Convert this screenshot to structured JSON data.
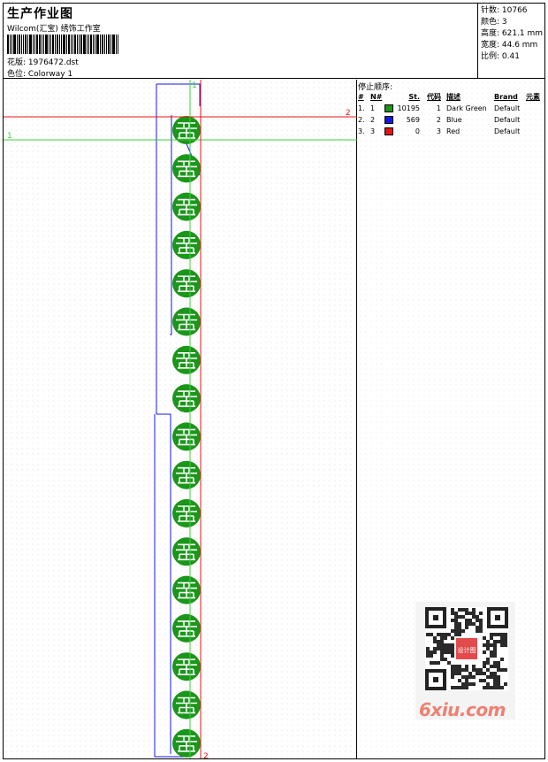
{
  "header": {
    "title": "生产作业图",
    "company": "Wilcom(汇宝) 绣饰工作室",
    "design": "花版:  1976472.dst",
    "colorway": "色位:  Colorway 1"
  },
  "stats": {
    "stitches": "针数:  10766",
    "colors": "颜色:  3",
    "height": "高度:  621.1 mm",
    "width": "宽度:  44.6 mm",
    "scale": "比例:  0.41"
  },
  "stop_sequence": {
    "heading": "停止顺序:",
    "columns": {
      "num": "#",
      "n": "N#",
      "stitches": "St.",
      "code": "代码",
      "desc": "描述",
      "brand": "Brand",
      "element": "元素"
    },
    "rows": [
      {
        "num": "1.",
        "n": "1",
        "color": "#1a961a",
        "stitches": "10195",
        "code": "1",
        "desc": "Dark Green",
        "brand": "Default"
      },
      {
        "num": "2.",
        "n": "2",
        "color": "#1515e6",
        "stitches": "569",
        "code": "2",
        "desc": "Blue",
        "brand": "Default"
      },
      {
        "num": "3.",
        "n": "3",
        "color": "#e61414",
        "stitches": "0",
        "code": "3",
        "desc": "Red",
        "brand": "Default"
      }
    ]
  },
  "guides": {
    "green_marker_top": "1",
    "green_marker_left": "1",
    "red_marker_right": "2",
    "red_marker_bottom": "2"
  },
  "motif": {
    "count": 17,
    "color": "#1a961a"
  },
  "watermark": {
    "text": "6xiu.com",
    "badge": "设计图"
  }
}
